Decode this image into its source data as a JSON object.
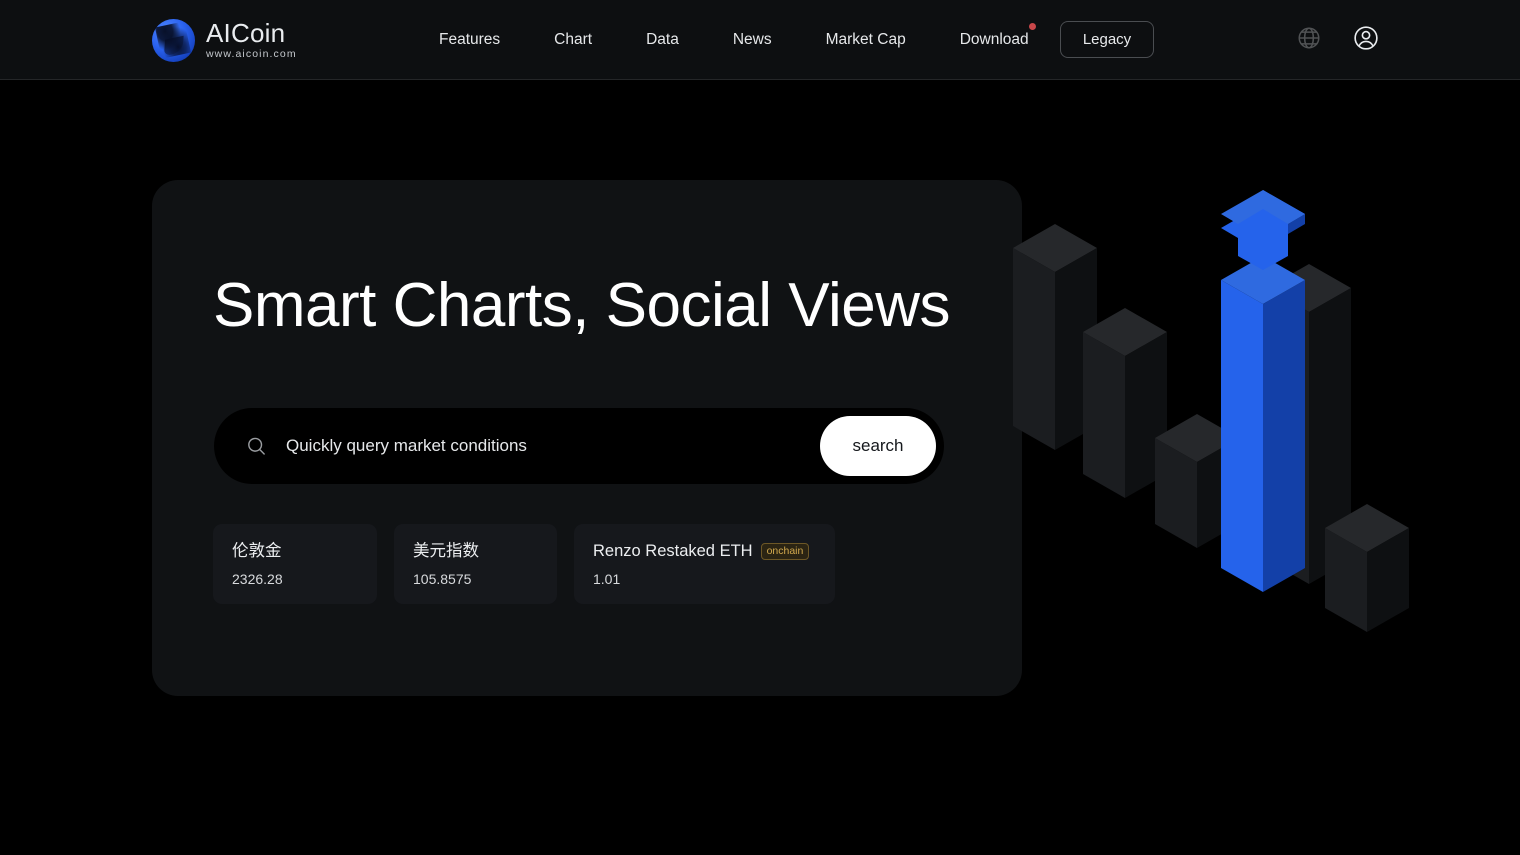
{
  "header": {
    "logo": {
      "icon": "aicoin-globe-logo-icon",
      "title": "AICoin",
      "subtitle": "www.aicoin.com"
    },
    "nav_items": [
      {
        "label": "Features",
        "badge": false
      },
      {
        "label": "Chart",
        "badge": false
      },
      {
        "label": "Data",
        "badge": false
      },
      {
        "label": "News",
        "badge": false
      },
      {
        "label": "Market Cap",
        "badge": false
      },
      {
        "label": "Download",
        "badge": true
      }
    ],
    "legacy_button": "Legacy",
    "icons": [
      {
        "name": "language-globe-icon"
      },
      {
        "name": "user-account-icon"
      }
    ],
    "badge_color": "#c8474a"
  },
  "hero": {
    "title": "Smart Charts, Social Views",
    "search": {
      "icon": "search-icon",
      "value": "",
      "placeholder": "Quickly query market conditions",
      "button_label": "search"
    },
    "tickers": [
      {
        "name": "伦敦金",
        "value": "2326.28",
        "badge": null
      },
      {
        "name": "美元指数",
        "value": "105.8575",
        "badge": null
      },
      {
        "name": "Renzo Restaked ETH",
        "value": "1.01",
        "badge": "onchain"
      }
    ]
  },
  "illustration": {
    "name": "isometric-bar-chart-illustration",
    "accent_color": "#2563eb",
    "bar_color": "#1d1f21"
  }
}
